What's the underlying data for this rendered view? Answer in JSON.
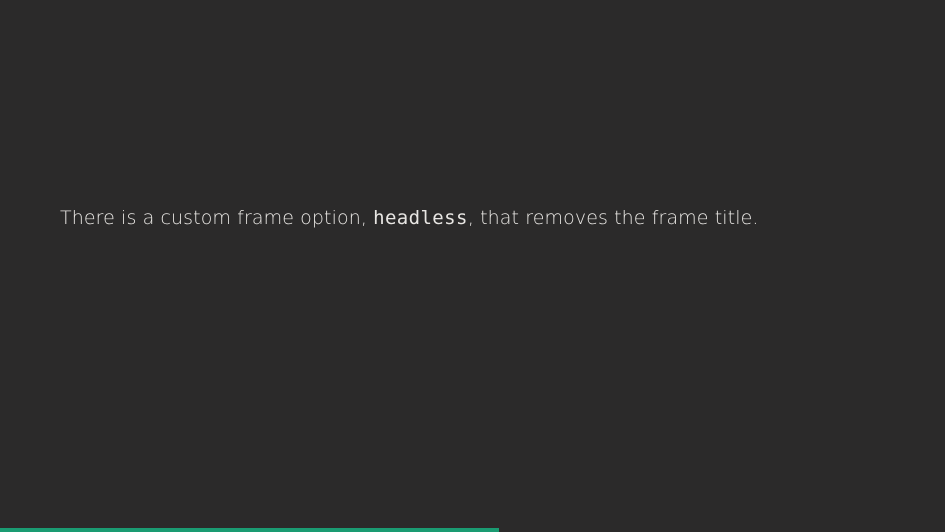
{
  "slide": {
    "text_before": "There is a custom frame option, ",
    "code": "headless",
    "text_after": ", that removes the frame title."
  },
  "progress": {
    "fraction": 0.528,
    "color": "#1a9b72"
  }
}
